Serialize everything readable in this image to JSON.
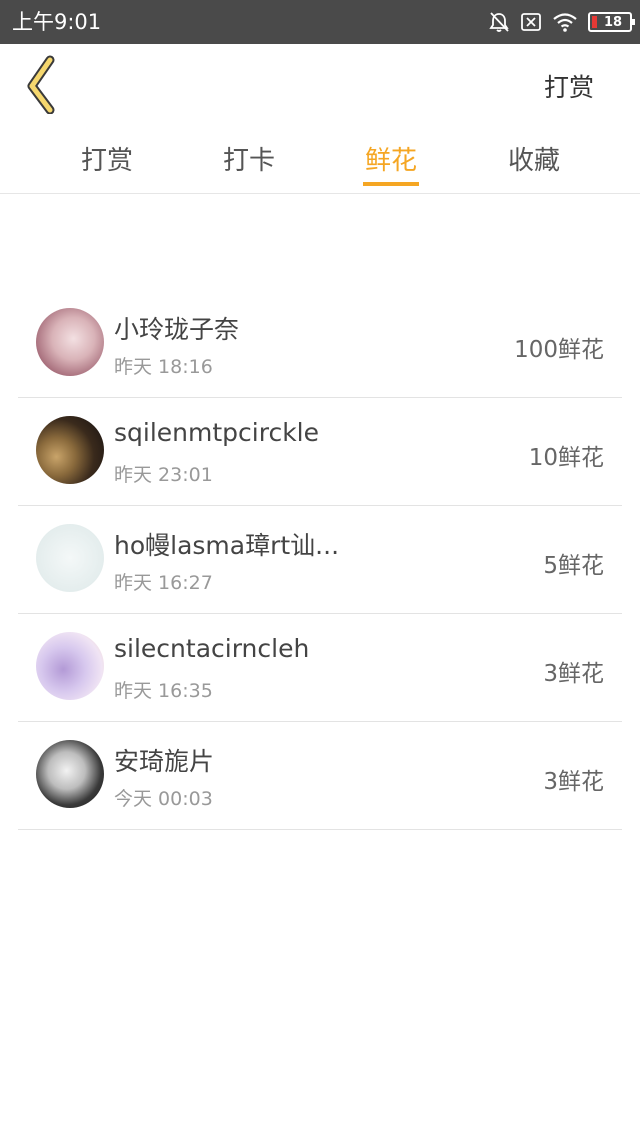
{
  "status_bar": {
    "time": "上午9:01",
    "icons": [
      "bell-off-icon",
      "sim-none-icon",
      "wifi-icon",
      "battery-icon"
    ],
    "battery_level": "18",
    "battery_color": "#e53935"
  },
  "header": {
    "back_icon": "chevron-left-icon",
    "action_label": "打赏",
    "accent": "#f5a623"
  },
  "tabs": [
    {
      "label": "打赏",
      "active": false
    },
    {
      "label": "打卡",
      "active": false
    },
    {
      "label": "鲜花",
      "active": true
    },
    {
      "label": "收藏",
      "active": false
    }
  ],
  "list": [
    {
      "name": "小玲珑子奈",
      "time": "昨天 18:16",
      "amount": "100鲜花"
    },
    {
      "name": "sqilenmtpcirckle",
      "time": "昨天 23:01",
      "amount": "10鲜花"
    },
    {
      "name": "ho幔lasma璋rt讪...",
      "time": "昨天 16:27",
      "amount": "5鲜花"
    },
    {
      "name": "silecntacirncleh",
      "time": "昨天 16:35",
      "amount": "3鲜花"
    },
    {
      "name": "安琦旎片",
      "time": "今天 00:03",
      "amount": "3鲜花"
    }
  ]
}
